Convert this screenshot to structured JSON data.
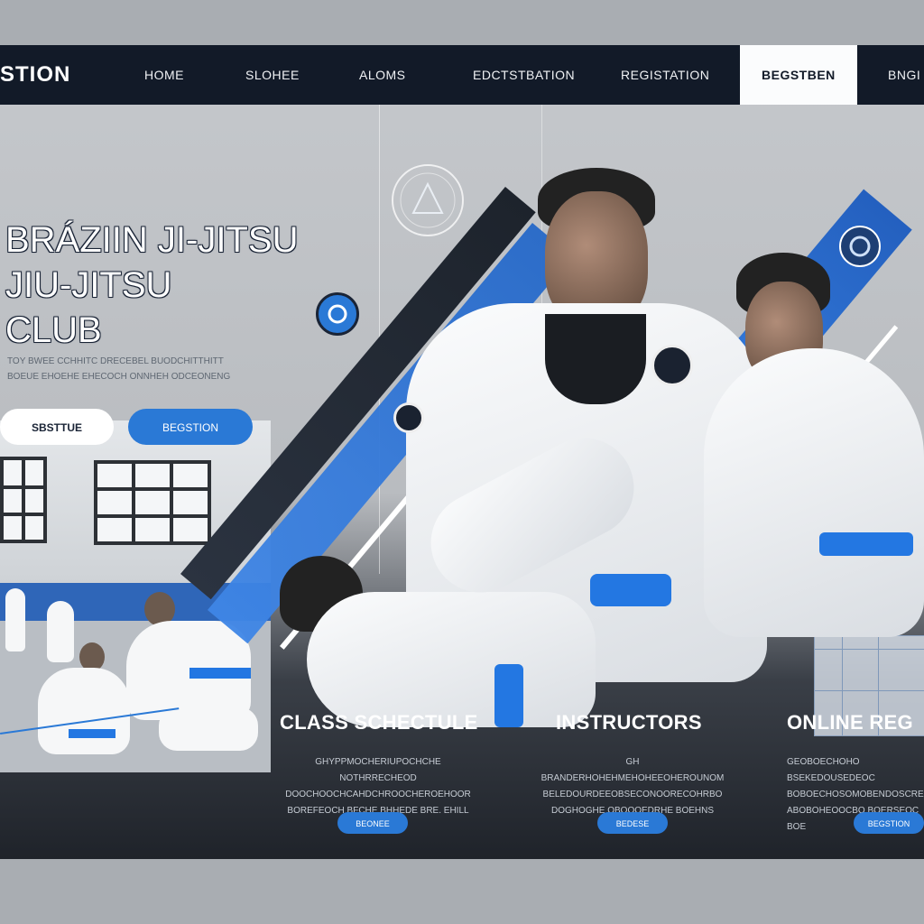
{
  "nav": {
    "brand": "STION",
    "items": [
      "HOME",
      "SLOHEE",
      "ALOMS",
      "EDCTSTBATION",
      "REGISTATION",
      "BEGSTBEN",
      "BNGI"
    ],
    "active_index": 5
  },
  "hero": {
    "title_lines": [
      "BRÁZIIN JI-JITSU",
      "JIU-JITSU",
      "CLUB"
    ],
    "subtitle_lines": [
      "TOY BWEE CCHHITC DRECEBEL BUODCHITTHITT",
      "BOEUE EHOEHE EHECOCH ONNHEH ODCEONENG"
    ],
    "button_white": "SBSTTUE",
    "button_blue": "BEGSTION"
  },
  "cards": [
    {
      "title": "CLASS SCHECTULE",
      "text_lines": [
        "GHYPPMOCHERIUPOCHCHE NOTHRRECHEOD",
        "DOOCHOOCHCAHDCHROOCHEROEHOOR",
        "BOREFEOCH BFCHE BHHEDE BRE. EHILL"
      ],
      "button": "BEONEE"
    },
    {
      "title": "INSTRUCTORS",
      "text_lines": [
        "GH BRANDERHOHEHMEHOHEEOHEROUNOM",
        "BELEDOURDEEOBSECONOORECOHRBO",
        "DOGHOGHE OBOOOEDRHE BOEHNS"
      ],
      "button": "BEDESE"
    },
    {
      "title": "ONLINE REG",
      "text_lines": [
        "GEOBOECHOHO BSEKEDOUSEDEOC",
        "BOBOECHOSOMOBENDOSCRESCHEC",
        "ABOBOHEOOCBO BOERSEOC BOE"
      ],
      "button": "BEGSTION"
    }
  ],
  "colors": {
    "nav_bg": "#121a28",
    "accent_blue": "#2a79d6",
    "stripe_blue": "#2f7be0",
    "belt_blue": "#2377e2"
  },
  "icons": [
    "emblem-icon",
    "logo-badge-icon",
    "gi-patch-icon"
  ]
}
